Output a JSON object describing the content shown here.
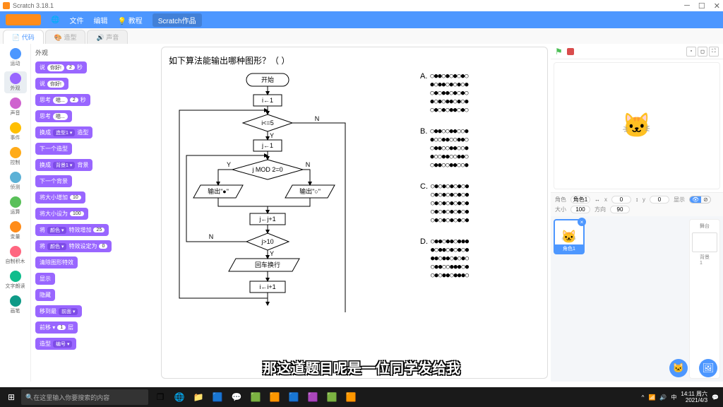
{
  "window": {
    "title": "Scratch 3.18.1"
  },
  "menu": {
    "file": "文件",
    "edit": "编辑",
    "tutorial": "教程",
    "works": "Scratch作品"
  },
  "tabs": {
    "code": "代码",
    "costume": "造型",
    "sound": "声音"
  },
  "categories": [
    {
      "name": "运动",
      "color": "#4c97ff"
    },
    {
      "name": "外观",
      "color": "#9966ff"
    },
    {
      "name": "声音",
      "color": "#cf63cf"
    },
    {
      "name": "事件",
      "color": "#ffbf00"
    },
    {
      "name": "控制",
      "color": "#ffab19"
    },
    {
      "name": "侦测",
      "color": "#5cb1d6"
    },
    {
      "name": "运算",
      "color": "#59c059"
    },
    {
      "name": "变量",
      "color": "#ff8c1a"
    },
    {
      "name": "自制积木",
      "color": "#ff6680"
    },
    {
      "name": "文字朗读",
      "color": "#0fbd8c"
    },
    {
      "name": "画笔",
      "color": "#0e9a87"
    }
  ],
  "palette": {
    "title": "外观",
    "blocks": [
      {
        "label": "说",
        "p1": "你好!",
        "p2": "2",
        "suffix": "秒"
      },
      {
        "label": "说",
        "p1": "你好!"
      },
      {
        "label": "思考",
        "p1": "嗯...",
        "p2": "2",
        "suffix": "秒"
      },
      {
        "label": "思考",
        "p1": "嗯..."
      },
      {
        "label": "换成",
        "sq": "造型1 ▾",
        "suffix": "造型"
      },
      {
        "label": "下一个造型"
      },
      {
        "label": "换成",
        "sq": "背景1 ▾",
        "suffix": "背景"
      },
      {
        "label": "下一个背景"
      },
      {
        "label": "将大小增加",
        "p1": "10"
      },
      {
        "label": "将大小设为",
        "p1": "100"
      },
      {
        "label": "将",
        "sq": "颜色 ▾",
        "mid": "特效增加",
        "p1": "25"
      },
      {
        "label": "将",
        "sq": "颜色 ▾",
        "mid": "特效设定为",
        "p1": "0"
      },
      {
        "label": "清除图形特效"
      },
      {
        "label": "显示"
      },
      {
        "label": "隐藏"
      },
      {
        "label": "移到最",
        "sq": "前面 ▾"
      },
      {
        "label": "前移 ▾",
        "p1": "1",
        "suffix": "层"
      },
      {
        "label": "造型",
        "sq": "编号 ▾"
      }
    ]
  },
  "question": {
    "title": "如下算法能输出哪种图形？（  ）",
    "flow": {
      "start": "开始",
      "i1": "i←1",
      "cond1": "i<=5",
      "j1": "j←1",
      "cond2": "j MOD 2=0",
      "out1": "输出\"●\"",
      "out2": "输出\"○\"",
      "jinc": "j←j+1",
      "cond3": "j>10",
      "newline": "回车换行",
      "iinc": "i←i+1",
      "Y": "Y",
      "N": "N"
    },
    "options": {
      "A": "○●●○●○●○●○\n●○●●○●○●○●\n○●○●●○●○●○\n●○●○●●○●○●\n○●○●○●●○●○",
      "B": "○●●○○●●○○●\n●○○●●○○●●○\n○●●○○●●○○●\n●○○●●○○●●○\n○●●○○●●○○●",
      "C": "○●○●○●○●○●\n○●○●○●○●○●\n○●○●○●○●○●\n○●○●○●○●○●\n○●○●○●○●○●",
      "D": "○●●○●●○●●●\n●○●●○●○●○●\n●●○●●○●○●○\n○●●○○●●●○●\n○●○●●○●●●○"
    }
  },
  "stage": {
    "sprite_label": "角色",
    "sprite_name": "角色1",
    "x_label": "x",
    "x": "0",
    "y_label": "y",
    "y": "0",
    "show_label": "显示",
    "size_label": "大小",
    "size": "100",
    "dir_label": "方向",
    "dir": "90",
    "stage_label": "舞台",
    "backdrop_label": "背景",
    "backdrop_count": "1"
  },
  "subtitle": "那这道题目呢是一位同学发给我",
  "taskbar": {
    "search_placeholder": "在这里输入你要搜索的内容",
    "time": "14:11 周六",
    "date": "2021/4/3"
  }
}
